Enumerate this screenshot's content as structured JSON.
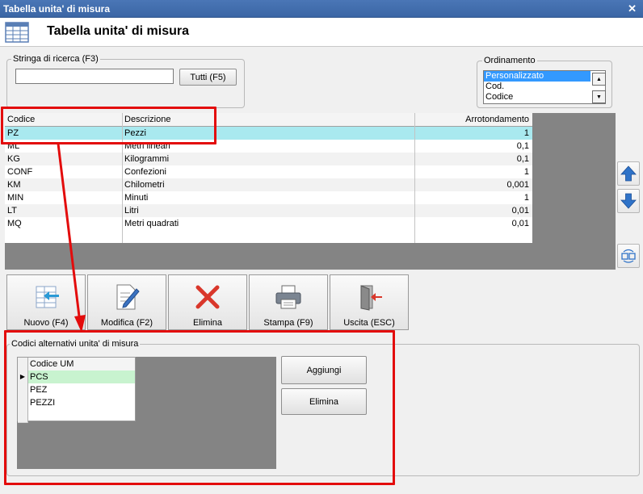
{
  "window": {
    "title": "Tabella unita' di misura",
    "close_glyph": "✕"
  },
  "header": {
    "title": "Tabella unita' di misura",
    "icon": "table-icon"
  },
  "search": {
    "legend": "Stringa di ricerca (F3)",
    "value": "",
    "placeholder": "",
    "all_button": "Tutti (F5)"
  },
  "sort": {
    "legend": "Ordinamento",
    "options": [
      "Personalizzato",
      "Cod.",
      "Codice"
    ],
    "selected": "Personalizzato"
  },
  "grid": {
    "columns": [
      "Codice",
      "Descrizione",
      "Arrotondamento"
    ],
    "rows": [
      {
        "code": "PZ",
        "desc": "Pezzi",
        "round": "1"
      },
      {
        "code": "ML",
        "desc": "Metri lineari",
        "round": "0,1"
      },
      {
        "code": "KG",
        "desc": "Kilogrammi",
        "round": "0,1"
      },
      {
        "code": "CONF",
        "desc": "Confezioni",
        "round": "1"
      },
      {
        "code": "KM",
        "desc": "Chilometri",
        "round": "0,001"
      },
      {
        "code": "MIN",
        "desc": "Minuti",
        "round": "1"
      },
      {
        "code": "LT",
        "desc": "Litri",
        "round": "0,01"
      },
      {
        "code": "MQ",
        "desc": "Metri quadrati",
        "round": "0,01"
      }
    ],
    "selected_index": 0
  },
  "toolbar": {
    "new": "Nuovo (F4)",
    "edit": "Modifica (F2)",
    "delete": "Elimina",
    "print": "Stampa (F9)",
    "exit": "Uscita (ESC)"
  },
  "alt_codes": {
    "legend": "Codici alternativi unita' di misura",
    "column": "Codice UM",
    "rows": [
      "PCS",
      "PEZ",
      "PEZZI"
    ],
    "add_button": "Aggiungi",
    "delete_button": "Elimina"
  },
  "colors": {
    "annotation": "#e30c0c",
    "selected_row": "#a9e9ef",
    "alt_selected_row": "#c8f3cf",
    "listbox_selection": "#3399ff",
    "arrow_blue": "#2f73c8"
  }
}
